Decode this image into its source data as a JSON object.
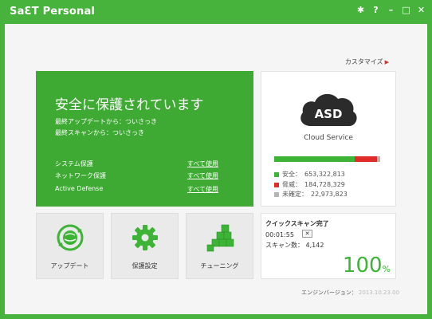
{
  "titlebar": {
    "app_title": "SaƐT Personal",
    "controls": [
      "settings-icon",
      "help-icon",
      "minimize-icon",
      "maximize-icon",
      "close-icon"
    ]
  },
  "customize": {
    "label": "カスタマイズ"
  },
  "status": {
    "title": "安全に保護されています",
    "last_update": "最終アップデートから：ついさっき",
    "last_scan": "最終スキャンから：ついさっき",
    "features": [
      {
        "name": "システム保護",
        "link": "すべて使用"
      },
      {
        "name": "ネットワーク保護",
        "link": "すべて使用"
      },
      {
        "name": "Active Defense",
        "link": "すべて使用"
      }
    ],
    "color": "#3ea933"
  },
  "cloud": {
    "logo_text": "ASD",
    "caption": "Cloud Service",
    "stats": [
      {
        "label": "安全：",
        "value": "653,322,813",
        "color": "#3db436"
      },
      {
        "label": "脅威：",
        "value": "184,728,329",
        "color": "#e02b2b"
      },
      {
        "label": "未確定：",
        "value": "22,973,823",
        "color": "#b5b5b5"
      }
    ],
    "bar_fractions": {
      "safe": 0.76,
      "threat": 0.21,
      "unknown": 0.03
    }
  },
  "tiles": [
    {
      "label": "アップデート",
      "icon": "update-globe-icon"
    },
    {
      "label": "保護設定",
      "icon": "gear-icon"
    },
    {
      "label": "チューニング",
      "icon": "tuning-cubes-icon"
    }
  ],
  "scan": {
    "title": "クイックスキャン完了",
    "elapsed": "00:01:55",
    "close_label": "✕",
    "count_label": "スキャン数：",
    "count": "4,142",
    "percent": "100",
    "percent_sign": "%"
  },
  "engine": {
    "label": "エンジンバージョン：",
    "value": "2013.10.23.00"
  }
}
